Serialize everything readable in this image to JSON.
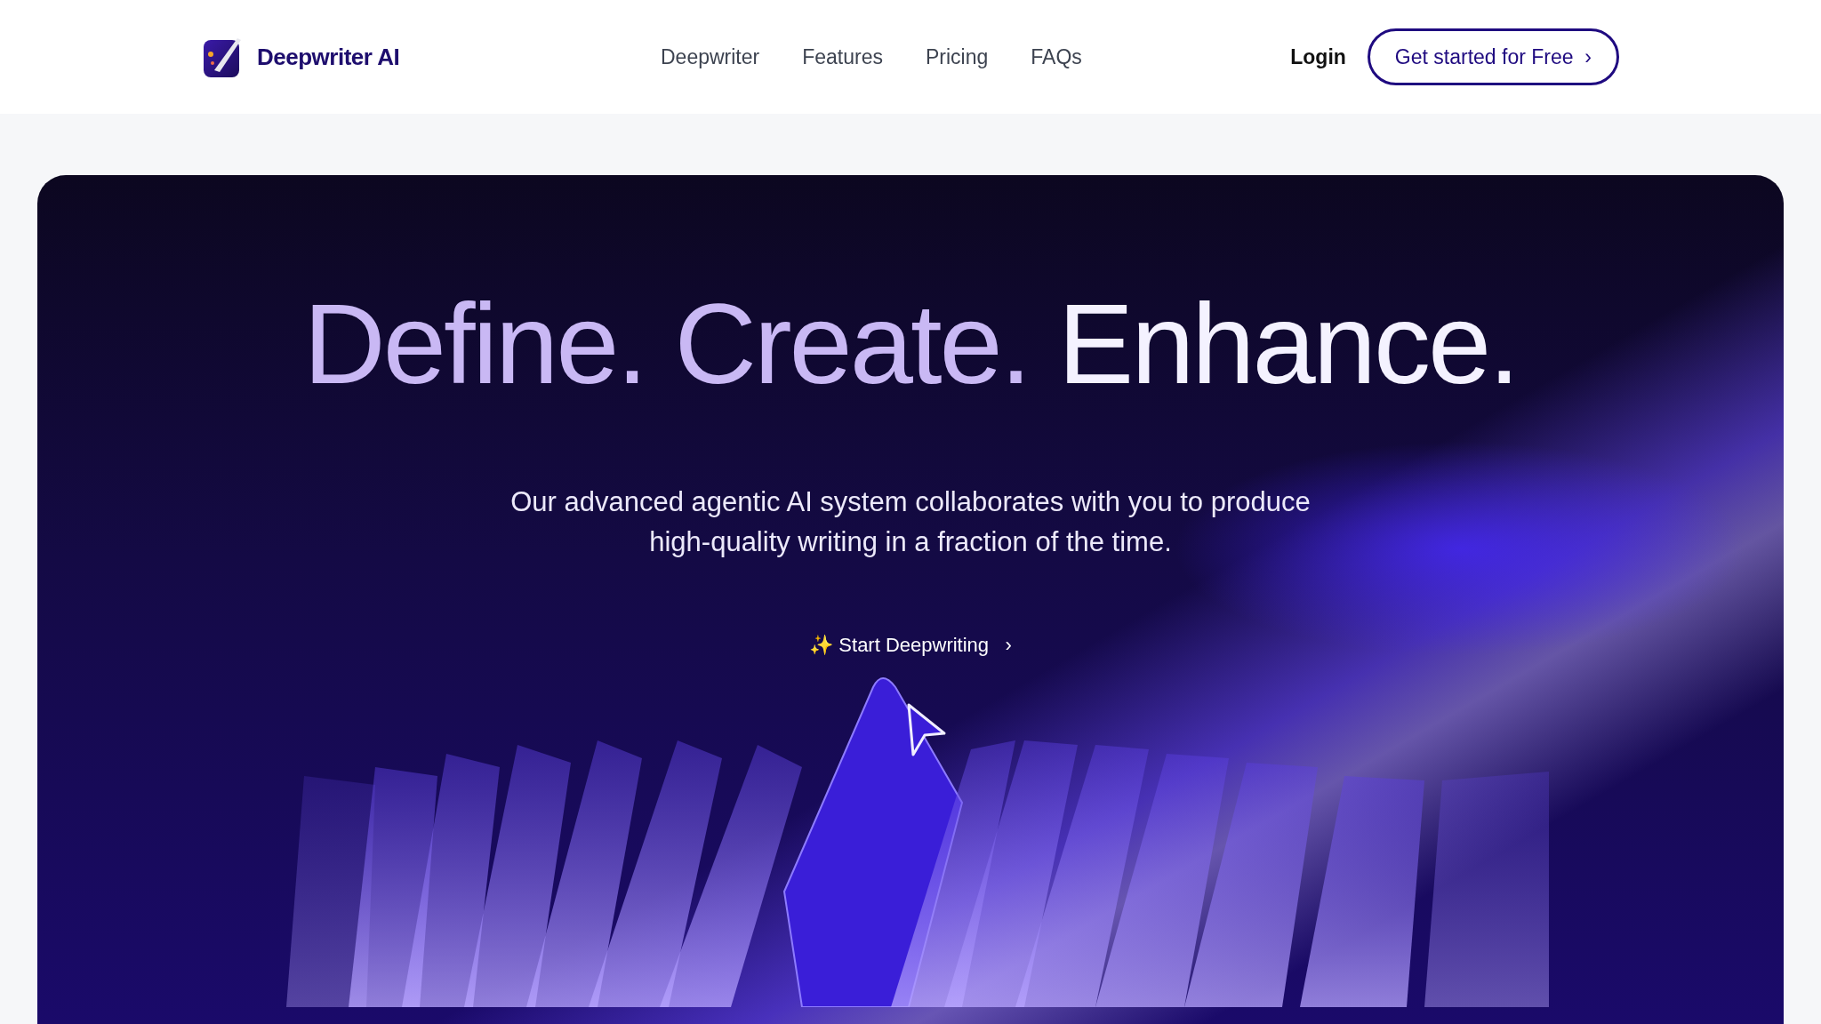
{
  "brand": {
    "name": "Deepwriter AI"
  },
  "nav": [
    {
      "label": "Deepwriter"
    },
    {
      "label": "Features"
    },
    {
      "label": "Pricing"
    },
    {
      "label": "FAQs"
    }
  ],
  "login": "Login",
  "cta": {
    "label": "Get started for Free",
    "arrow": "›"
  },
  "headline": [
    {
      "text": "Define.",
      "emphasis": false
    },
    {
      "text": "Create.",
      "emphasis": false
    },
    {
      "text": "Enhance.",
      "emphasis": true
    }
  ],
  "subtitle": [
    "Our advanced agentic AI system collaborates with you to produce",
    "high-quality writing in a fraction of the time."
  ],
  "start": {
    "icon": "✨",
    "label": "Start Deepwriting",
    "arrow": "›"
  }
}
